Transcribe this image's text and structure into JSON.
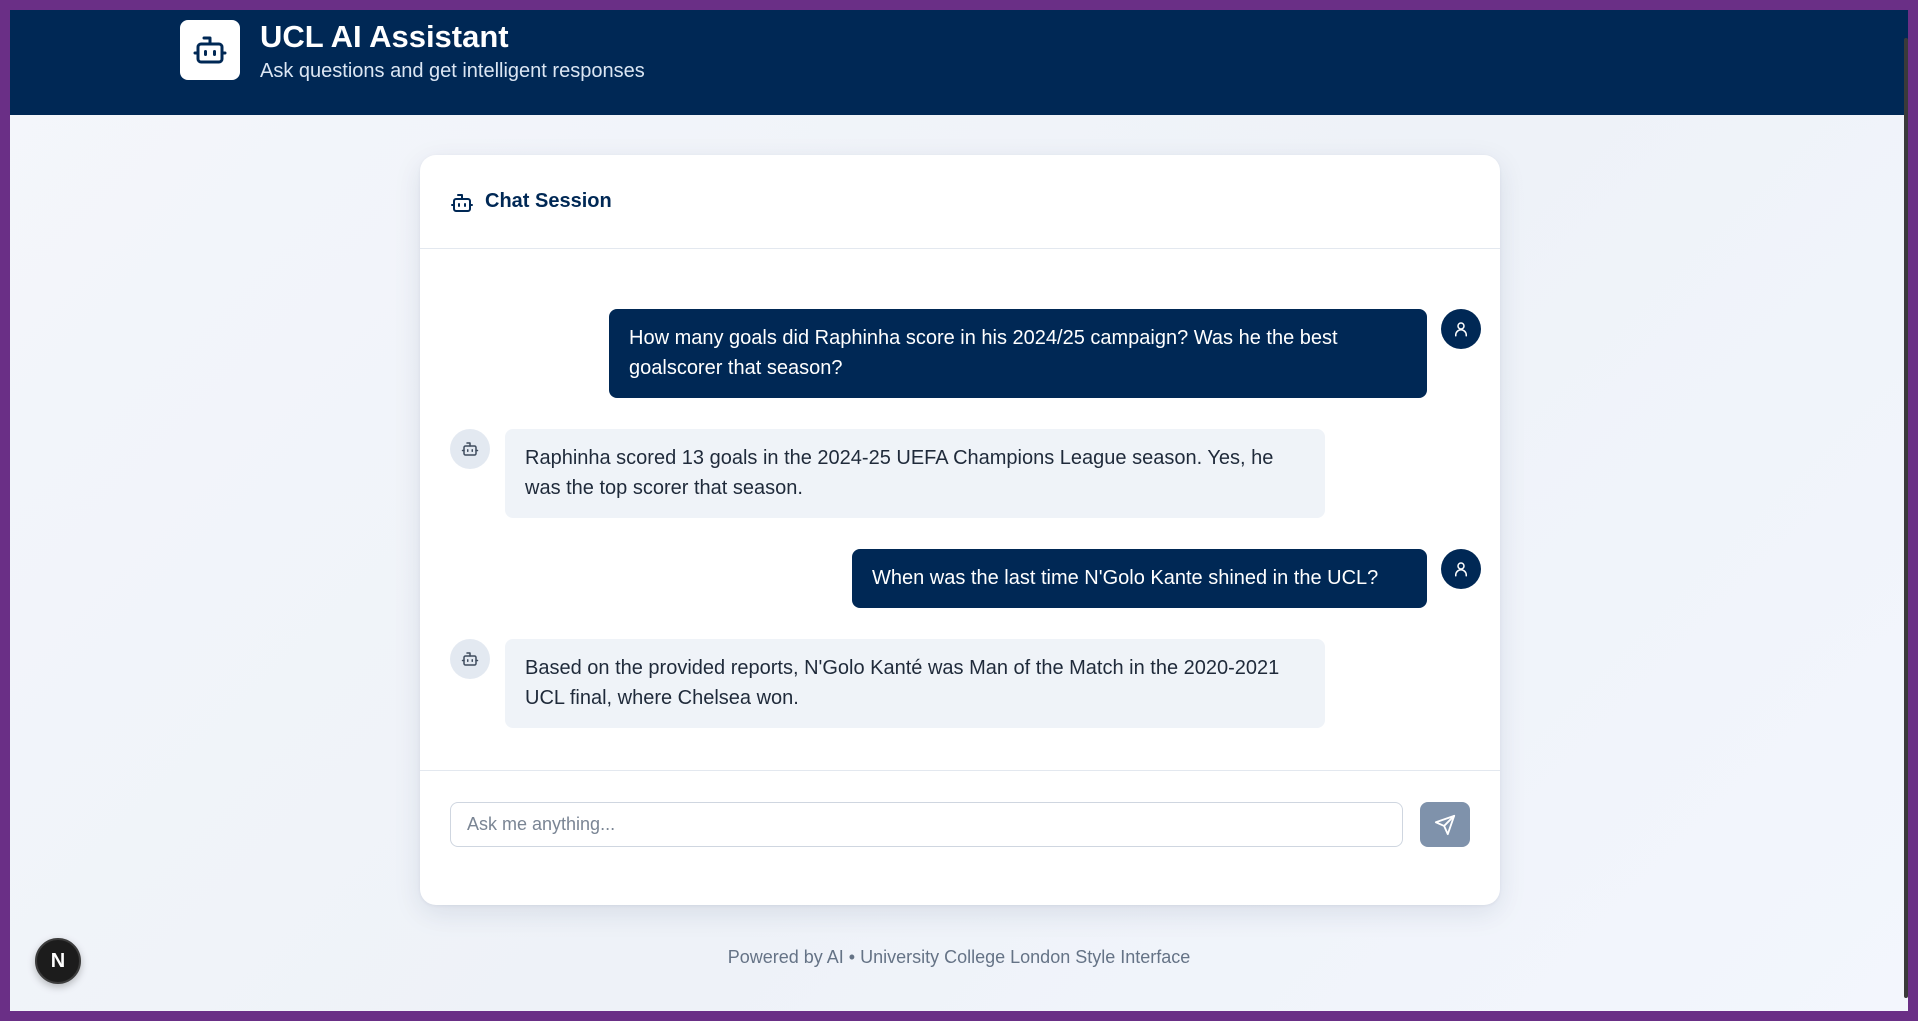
{
  "header": {
    "title": "UCL AI Assistant",
    "subtitle": "Ask questions and get intelligent responses",
    "logo_icon": "robot-icon"
  },
  "chat": {
    "title": "Chat Session",
    "title_icon": "robot-icon",
    "messages": [
      {
        "role": "user",
        "text": "How many goals did Raphinha score in his 2024/25 campaign? Was he the best goalscorer that season?",
        "avatar_icon": "user-icon"
      },
      {
        "role": "assistant",
        "text": "Raphinha scored 13 goals in the 2024-25 UEFA Champions League season. Yes, he was the top scorer that season.",
        "avatar_icon": "robot-icon"
      },
      {
        "role": "user",
        "text": "When was the last time N'Golo Kante shined in the UCL?",
        "avatar_icon": "user-icon"
      },
      {
        "role": "assistant",
        "text": "Based on the provided reports, N'Golo Kanté was Man of the Match in the 2020-2021 UCL final, where Chelsea won.",
        "avatar_icon": "robot-icon"
      }
    ],
    "input": {
      "placeholder": "Ask me anything...",
      "value": ""
    },
    "send_icon": "send-icon"
  },
  "footer": {
    "text": "Powered by AI • University College London Style Interface"
  },
  "dev_badge": {
    "label": "N"
  },
  "colors": {
    "primary": "#002855",
    "bot_bubble": "#eff3f8",
    "send_button": "#7f92ab",
    "window_border": "#6a2f86"
  }
}
